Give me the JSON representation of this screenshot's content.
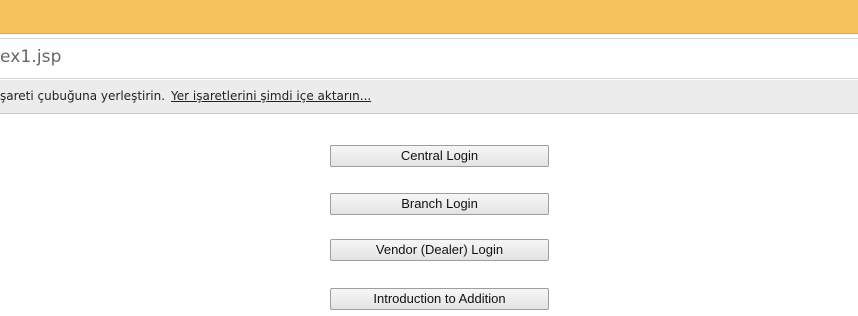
{
  "browser": {
    "address_text": "ex1.jsp",
    "bookmark_bar": {
      "message": "şareti çubuğuna yerleştirin.",
      "import_link": "Yer işaretlerini şimdi içe aktarın..."
    }
  },
  "main": {
    "buttons": [
      {
        "label": "Central Login"
      },
      {
        "label": "Branch Login"
      },
      {
        "label": "Vendor (Dealer) Login"
      },
      {
        "label": "Introduction to Addition"
      }
    ]
  },
  "colors": {
    "title_strip": "#f5c25e",
    "bookmark_bar": "#ececec",
    "button_border": "#9e9e9e"
  }
}
